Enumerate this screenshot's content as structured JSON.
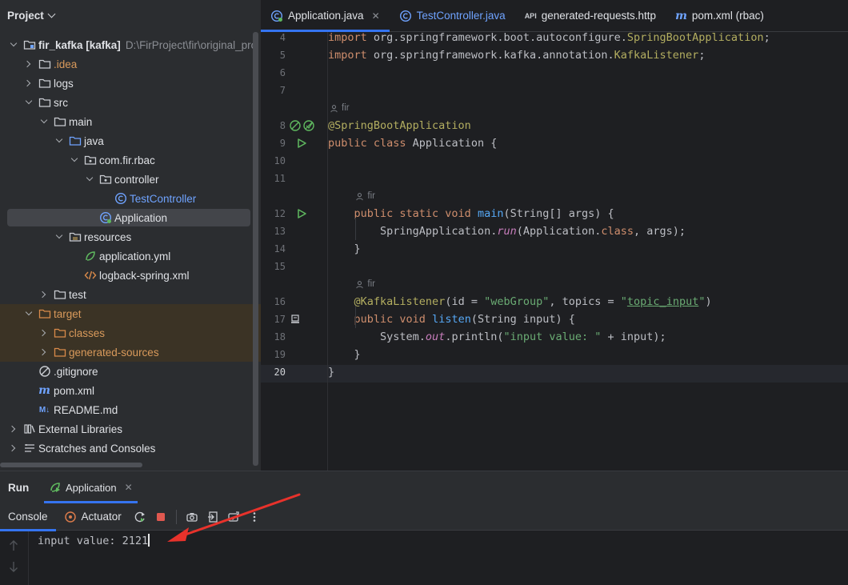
{
  "project_panel": {
    "title": "Project",
    "tree": [
      {
        "label": "fir_kafka [kafka]",
        "path": "D:\\FirProject\\fir\\original_pro",
        "icon": "module-folder-icon",
        "depth": 0,
        "expanded": true
      },
      {
        "label": ".idea",
        "icon": "folder-icon",
        "depth": 1,
        "expanded": false,
        "style": "orange"
      },
      {
        "label": "logs",
        "icon": "folder-icon",
        "depth": 1,
        "expanded": false
      },
      {
        "label": "src",
        "icon": "folder-icon",
        "depth": 1,
        "expanded": true
      },
      {
        "label": "main",
        "icon": "folder-icon",
        "depth": 2,
        "expanded": true
      },
      {
        "label": "java",
        "icon": "source-folder-icon",
        "depth": 3,
        "expanded": true
      },
      {
        "label": "com.fir.rbac",
        "icon": "package-icon",
        "depth": 4,
        "expanded": true
      },
      {
        "label": "controller",
        "icon": "package-icon",
        "depth": 5,
        "expanded": true
      },
      {
        "label": "TestController",
        "icon": "java-class-icon",
        "depth": 6,
        "style": "blue"
      },
      {
        "label": "Application",
        "icon": "spring-boot-class-icon",
        "depth": 5,
        "selected": true
      },
      {
        "label": "resources",
        "icon": "resources-folder-icon",
        "depth": 3,
        "expanded": true
      },
      {
        "label": "application.yml",
        "icon": "spring-yml-icon",
        "depth": 4
      },
      {
        "label": "logback-spring.xml",
        "icon": "xml-icon",
        "depth": 4
      },
      {
        "label": "test",
        "icon": "folder-icon",
        "depth": 2,
        "expanded": false
      },
      {
        "label": "target",
        "icon": "excluded-folder-icon",
        "depth": 1,
        "expanded": true,
        "style": "orange",
        "excluded": true
      },
      {
        "label": "classes",
        "icon": "excluded-folder-icon",
        "depth": 2,
        "expanded": false,
        "style": "orange",
        "excluded": true
      },
      {
        "label": "generated-sources",
        "icon": "excluded-folder-icon",
        "depth": 2,
        "expanded": false,
        "style": "orange",
        "excluded": true
      },
      {
        "label": ".gitignore",
        "icon": "gitignore-icon",
        "depth": 1
      },
      {
        "label": "pom.xml",
        "icon": "maven-icon",
        "depth": 1
      },
      {
        "label": "README.md",
        "icon": "markdown-icon",
        "depth": 1
      },
      {
        "label": "External Libraries",
        "icon": "libraries-icon",
        "depth": 0,
        "expanded": false
      },
      {
        "label": "Scratches and Consoles",
        "icon": "scratches-icon",
        "depth": 0,
        "expanded": false
      }
    ]
  },
  "editor": {
    "tabs": [
      {
        "label": "Application.java",
        "icon": "spring-boot-class-icon",
        "active": true,
        "closable": true
      },
      {
        "label": "TestController.java",
        "icon": "java-class-icon",
        "style": "blue"
      },
      {
        "label": "generated-requests.http",
        "icon": "http-request-icon"
      },
      {
        "label": "pom.xml (rbac)",
        "icon": "maven-icon"
      }
    ],
    "author_hint": "fir",
    "lines": [
      {
        "n": "4",
        "code": [
          [
            "kw",
            "import "
          ],
          [
            "plain",
            "org.springframework.boot.autoconfigure."
          ],
          [
            "ann",
            "SpringBootApplication"
          ],
          [
            "plain",
            ";"
          ]
        ]
      },
      {
        "n": "5",
        "code": [
          [
            "kw",
            "import "
          ],
          [
            "plain",
            "org.springframework.kafka.annotation."
          ],
          [
            "ann",
            "KafkaListener"
          ],
          [
            "plain",
            ";"
          ]
        ]
      },
      {
        "n": "6",
        "code": []
      },
      {
        "n": "7",
        "code": []
      },
      {
        "hint": true,
        "indent": 0
      },
      {
        "n": "8",
        "code": [
          [
            "ann",
            "@SpringBootApplication"
          ]
        ],
        "gutter": "spring-bean-icons"
      },
      {
        "n": "9",
        "code": [
          [
            "kw",
            "public class "
          ],
          [
            "plain",
            "Application {"
          ]
        ],
        "gutter": "run-icon"
      },
      {
        "n": "10",
        "code": []
      },
      {
        "n": "11",
        "code": []
      },
      {
        "hint": true,
        "indent": 4
      },
      {
        "n": "12",
        "code": [
          [
            "plain",
            "    "
          ],
          [
            "kw",
            "public static void "
          ],
          [
            "fn",
            "main"
          ],
          [
            "plain",
            "(String[] args) {"
          ]
        ],
        "gutter": "run-icon"
      },
      {
        "n": "13",
        "code": [
          [
            "plain",
            "        SpringApplication."
          ],
          [
            "it",
            "run"
          ],
          [
            "plain",
            "(Application."
          ],
          [
            "kw",
            "class"
          ],
          [
            "plain",
            ", args);"
          ]
        ]
      },
      {
        "n": "14",
        "code": [
          [
            "plain",
            "    }"
          ]
        ]
      },
      {
        "n": "15",
        "code": []
      },
      {
        "hint": true,
        "indent": 4
      },
      {
        "n": "16",
        "code": [
          [
            "plain",
            "    "
          ],
          [
            "ann",
            "@KafkaListener"
          ],
          [
            "plain",
            "(id = "
          ],
          [
            "str",
            "\"webGroup\""
          ],
          [
            "plain",
            ", topics = "
          ],
          [
            "str",
            "\""
          ],
          [
            "strU",
            "topic_input"
          ],
          [
            "str",
            "\""
          ],
          [
            "plain",
            ")"
          ]
        ]
      },
      {
        "n": "17",
        "code": [
          [
            "plain",
            "    "
          ],
          [
            "kw",
            "public void "
          ],
          [
            "fn",
            "listen"
          ],
          [
            "plain",
            "(String input) {"
          ]
        ],
        "gutter": "listener-icon"
      },
      {
        "n": "18",
        "code": [
          [
            "plain",
            "        System."
          ],
          [
            "it",
            "out"
          ],
          [
            "plain",
            ".println("
          ],
          [
            "str",
            "\"input value: \""
          ],
          [
            "plain",
            " + input);"
          ]
        ]
      },
      {
        "n": "19",
        "code": [
          [
            "plain",
            "    }"
          ]
        ]
      },
      {
        "n": "20",
        "code": [
          [
            "plain",
            "}"
          ]
        ],
        "current": true
      }
    ]
  },
  "run_panel": {
    "title": "Run",
    "run_tab": "Application",
    "console_tab": "Console",
    "actuator_tab": "Actuator",
    "output": "input value: 2121",
    "colors": {
      "accent": "#3574f0",
      "annotation_arrow": "#e8322b"
    }
  }
}
